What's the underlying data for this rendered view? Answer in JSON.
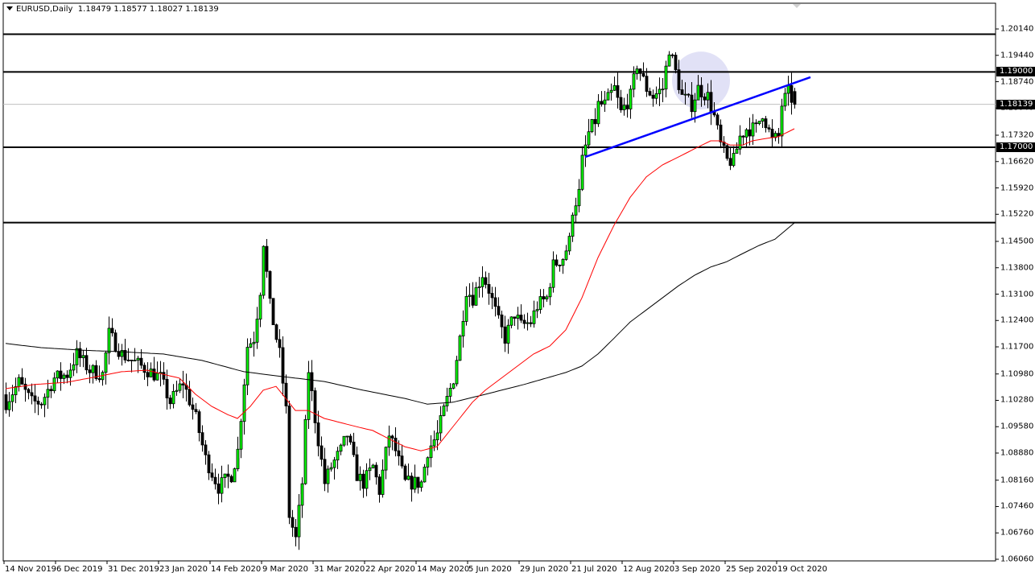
{
  "header": {
    "symbol": "EURUSD,Daily",
    "ohlc": "1.18479 1.18577 1.18027 1.18139"
  },
  "colors": {
    "bull": "#00ff00",
    "bear": "#000000",
    "ma_fast": "#ff0000",
    "ma_slow": "#000000",
    "trendline": "#0000ff",
    "highlight": "#dcdcf5"
  },
  "chart_data": {
    "type": "candlestick",
    "title": "EURUSD,Daily",
    "ylim": [
      1.0606,
      1.2014
    ],
    "y_ticks": [
      "1.20140",
      "1.19440",
      "1.18740",
      "1.18040",
      "1.17320",
      "1.16620",
      "1.15920",
      "1.15220",
      "1.14500",
      "1.13800",
      "1.13100",
      "1.12400",
      "1.11700",
      "1.10980",
      "1.10280",
      "1.09580",
      "1.08880",
      "1.08160",
      "1.07460",
      "1.06760",
      "1.06060"
    ],
    "x_ticks": [
      {
        "bar": 0,
        "label": "14 Nov 2019"
      },
      {
        "bar": 16,
        "label": "6 Dec 2019"
      },
      {
        "bar": 32,
        "label": "31 Dec 2019"
      },
      {
        "bar": 48,
        "label": "23 Jan 2020"
      },
      {
        "bar": 64,
        "label": "14 Feb 2020"
      },
      {
        "bar": 80,
        "label": "9 Mar 2020"
      },
      {
        "bar": 96,
        "label": "31 Mar 2020"
      },
      {
        "bar": 112,
        "label": "22 Apr 2020"
      },
      {
        "bar": 128,
        "label": "14 May 2020"
      },
      {
        "bar": 144,
        "label": "5 Jun 2020"
      },
      {
        "bar": 160,
        "label": "29 Jun 2020"
      },
      {
        "bar": 176,
        "label": "21 Jul 2020"
      },
      {
        "bar": 192,
        "label": "12 Aug 2020"
      },
      {
        "bar": 208,
        "label": "3 Sep 2020"
      },
      {
        "bar": 224,
        "label": "25 Sep 2020"
      },
      {
        "bar": 240,
        "label": "19 Oct 2020"
      }
    ],
    "bar_count": 246,
    "last_bar": {
      "open": 1.18479,
      "high": 1.18577,
      "low": 1.18027,
      "close": 1.18139
    },
    "close_anchors": [
      [
        0,
        1.1023
      ],
      [
        4,
        1.1076
      ],
      [
        8,
        1.1023
      ],
      [
        11,
        1.1023
      ],
      [
        15,
        1.1087
      ],
      [
        19,
        1.1097
      ],
      [
        22,
        1.1151
      ],
      [
        26,
        1.1108
      ],
      [
        30,
        1.1097
      ],
      [
        32,
        1.1204
      ],
      [
        36,
        1.1151
      ],
      [
        40,
        1.1129
      ],
      [
        44,
        1.1108
      ],
      [
        48,
        1.1087
      ],
      [
        51,
        1.1023
      ],
      [
        55,
        1.1076
      ],
      [
        59,
        1.098
      ],
      [
        62,
        1.0873
      ],
      [
        66,
        1.0798
      ],
      [
        70,
        1.083
      ],
      [
        72,
        1.0894
      ],
      [
        75,
        1.1172
      ],
      [
        77,
        1.1193
      ],
      [
        79,
        1.1322
      ],
      [
        80,
        1.145
      ],
      [
        82,
        1.1279
      ],
      [
        84,
        1.1193
      ],
      [
        85,
        1.1151
      ],
      [
        87,
        1.1001
      ],
      [
        88,
        1.0723
      ],
      [
        90,
        1.0659
      ],
      [
        92,
        1.0809
      ],
      [
        93,
        1.0958
      ],
      [
        94,
        1.1108
      ],
      [
        96,
        1.098
      ],
      [
        99,
        1.0809
      ],
      [
        101,
        1.0852
      ],
      [
        104,
        1.0894
      ],
      [
        106,
        1.0937
      ],
      [
        109,
        1.083
      ],
      [
        111,
        1.0809
      ],
      [
        114,
        1.0852
      ],
      [
        116,
        1.0788
      ],
      [
        119,
        1.0937
      ],
      [
        121,
        1.0894
      ],
      [
        124,
        1.0809
      ],
      [
        126,
        1.0809
      ],
      [
        129,
        1.0809
      ],
      [
        131,
        1.0894
      ],
      [
        134,
        1.0937
      ],
      [
        136,
        1.1001
      ],
      [
        139,
        1.1087
      ],
      [
        141,
        1.1193
      ],
      [
        143,
        1.1322
      ],
      [
        145,
        1.13
      ],
      [
        148,
        1.1364
      ],
      [
        150,
        1.1322
      ],
      [
        153,
        1.1236
      ],
      [
        155,
        1.1193
      ],
      [
        158,
        1.1258
      ],
      [
        160,
        1.1226
      ],
      [
        163,
        1.1236
      ],
      [
        165,
        1.1279
      ],
      [
        168,
        1.13
      ],
      [
        170,
        1.1386
      ],
      [
        173,
        1.1407
      ],
      [
        175,
        1.145
      ],
      [
        176,
        1.1535
      ],
      [
        178,
        1.1578
      ],
      [
        179,
        1.1664
      ],
      [
        181,
        1.1738
      ],
      [
        183,
        1.177
      ],
      [
        184,
        1.1813
      ],
      [
        186,
        1.1813
      ],
      [
        189,
        1.1856
      ],
      [
        191,
        1.1792
      ],
      [
        194,
        1.1835
      ],
      [
        196,
        1.192
      ],
      [
        199,
        1.1856
      ],
      [
        201,
        1.1835
      ],
      [
        204,
        1.1856
      ],
      [
        206,
        1.1963
      ],
      [
        208,
        1.1899
      ],
      [
        210,
        1.1835
      ],
      [
        213,
        1.1813
      ],
      [
        215,
        1.1856
      ],
      [
        218,
        1.1835
      ],
      [
        220,
        1.1781
      ],
      [
        222,
        1.1706
      ],
      [
        224,
        1.1664
      ],
      [
        226,
        1.1664
      ],
      [
        228,
        1.1728
      ],
      [
        230,
        1.1749
      ],
      [
        233,
        1.1749
      ],
      [
        235,
        1.1792
      ],
      [
        238,
        1.1717
      ],
      [
        240,
        1.1728
      ],
      [
        241,
        1.1813
      ],
      [
        243,
        1.1845
      ],
      [
        245,
        1.18139
      ]
    ],
    "ma_fast_anchors": [
      [
        0,
        1.1059
      ],
      [
        9,
        1.107
      ],
      [
        19,
        1.1076
      ],
      [
        26,
        1.1087
      ],
      [
        36,
        1.1104
      ],
      [
        44,
        1.1108
      ],
      [
        49,
        1.1097
      ],
      [
        54,
        1.1087
      ],
      [
        59,
        1.1044
      ],
      [
        64,
        1.1012
      ],
      [
        69,
        1.099
      ],
      [
        72,
        1.098
      ],
      [
        76,
        1.1012
      ],
      [
        80,
        1.1055
      ],
      [
        84,
        1.1065
      ],
      [
        86,
        1.1044
      ],
      [
        90,
        1.1001
      ],
      [
        94,
        1.1001
      ],
      [
        99,
        1.098
      ],
      [
        104,
        1.0969
      ],
      [
        109,
        1.0958
      ],
      [
        114,
        1.0948
      ],
      [
        119,
        1.0926
      ],
      [
        124,
        1.0905
      ],
      [
        129,
        1.0894
      ],
      [
        134,
        1.0905
      ],
      [
        137,
        1.0937
      ],
      [
        141,
        1.098
      ],
      [
        145,
        1.1023
      ],
      [
        149,
        1.1055
      ],
      [
        154,
        1.1087
      ],
      [
        159,
        1.1119
      ],
      [
        164,
        1.1151
      ],
      [
        169,
        1.1172
      ],
      [
        174,
        1.1215
      ],
      [
        179,
        1.13
      ],
      [
        184,
        1.1407
      ],
      [
        189,
        1.1493
      ],
      [
        194,
        1.1567
      ],
      [
        199,
        1.1621
      ],
      [
        204,
        1.1653
      ],
      [
        209,
        1.1674
      ],
      [
        214,
        1.1696
      ],
      [
        219,
        1.1717
      ],
      [
        222,
        1.1717
      ],
      [
        225,
        1.1706
      ],
      [
        229,
        1.1706
      ],
      [
        232,
        1.1717
      ],
      [
        236,
        1.1723
      ],
      [
        240,
        1.1728
      ],
      [
        245,
        1.1749
      ]
    ],
    "ma_slow_anchors": [
      [
        0,
        1.1179
      ],
      [
        11,
        1.1168
      ],
      [
        24,
        1.1161
      ],
      [
        36,
        1.1157
      ],
      [
        49,
        1.1151
      ],
      [
        61,
        1.1134
      ],
      [
        74,
        1.1104
      ],
      [
        86,
        1.1091
      ],
      [
        99,
        1.1078
      ],
      [
        111,
        1.1055
      ],
      [
        124,
        1.1033
      ],
      [
        131,
        1.1018
      ],
      [
        139,
        1.1023
      ],
      [
        149,
        1.1044
      ],
      [
        161,
        1.107
      ],
      [
        174,
        1.1102
      ],
      [
        179,
        1.1119
      ],
      [
        184,
        1.1151
      ],
      [
        189,
        1.1193
      ],
      [
        194,
        1.1236
      ],
      [
        199,
        1.1268
      ],
      [
        204,
        1.13
      ],
      [
        209,
        1.1332
      ],
      [
        214,
        1.136
      ],
      [
        219,
        1.1382
      ],
      [
        224,
        1.1396
      ],
      [
        229,
        1.1418
      ],
      [
        234,
        1.1439
      ],
      [
        239,
        1.1456
      ],
      [
        245,
        1.1499
      ]
    ],
    "horizontal_levels": [
      {
        "price": 1.2,
        "label": ""
      },
      {
        "price": 1.19,
        "label": "1.19000"
      },
      {
        "price": 1.17,
        "label": "1.17000"
      },
      {
        "price": 1.15,
        "label": ""
      }
    ],
    "bid_line": {
      "price": 1.18139,
      "label": "1.18139"
    },
    "trendline": {
      "from": [
        180,
        1.1674
      ],
      "to": [
        250,
        1.1886
      ]
    },
    "highlight_circle": {
      "bar": 216,
      "price": 1.1877
    }
  }
}
